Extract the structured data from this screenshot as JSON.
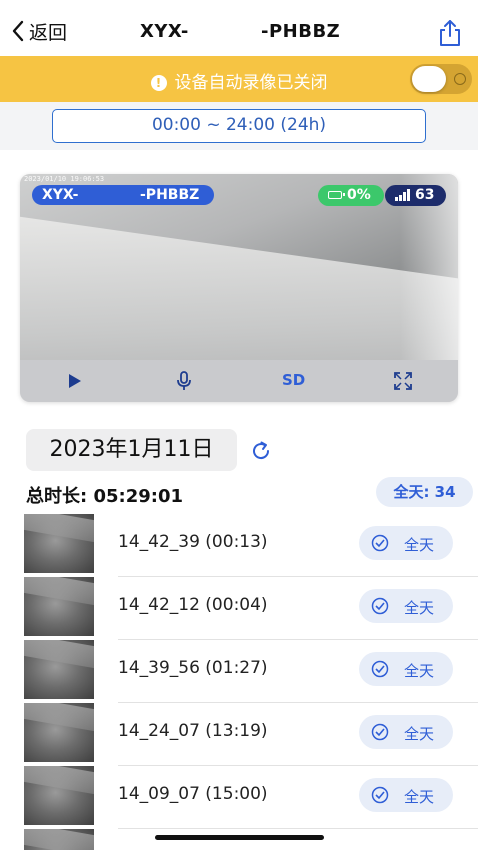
{
  "header": {
    "back_label": "返回",
    "title_left": "XYX-",
    "title_right": "-PHBBZ"
  },
  "banner": {
    "text": "设备自动录像已关闭",
    "toggle_on": false,
    "color": "#f6c443"
  },
  "time_range": "00:00 ~ 24:00 (24h)",
  "video": {
    "timestamp": "2023/01/10 19:06:53",
    "device_left": "XYX-",
    "device_right": "-PHBBZ",
    "battery": "0%",
    "signal": "63",
    "quality": "SD"
  },
  "date": "2023年1月11日",
  "total_duration": "总时长: 05:29:01",
  "allday_count": "全天: 34",
  "recordings": [
    {
      "label": "14_42_39 (00:13)",
      "badge": "全天"
    },
    {
      "label": "14_42_12 (00:04)",
      "badge": "全天"
    },
    {
      "label": "14_39_56 (01:27)",
      "badge": "全天"
    },
    {
      "label": "14_24_07 (13:19)",
      "badge": "全天"
    },
    {
      "label": "14_09_07 (15:00)",
      "badge": "全天"
    }
  ],
  "colors": {
    "accent": "#2f5ed6",
    "banner": "#f6c443",
    "battery": "#3cc86b",
    "signal": "#1d2c6b"
  }
}
